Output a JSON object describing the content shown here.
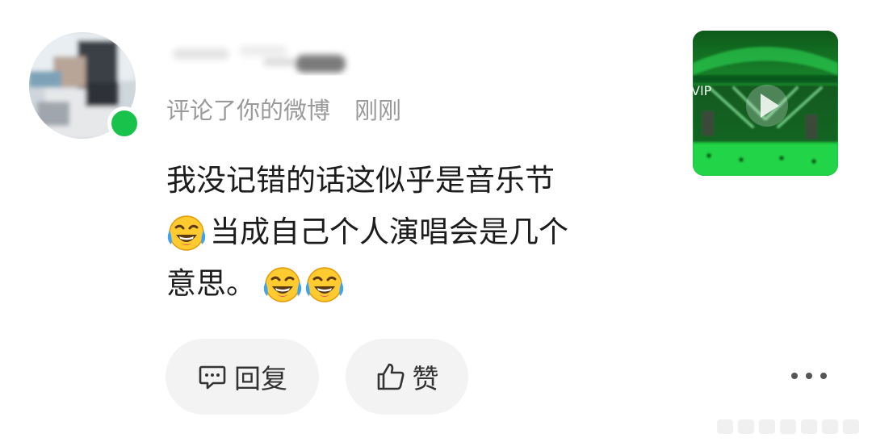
{
  "comment_card": {
    "action_text": "评论了你的微博",
    "time": "刚刚",
    "content_lines": [
      "我没记错的话这似乎是音乐节",
      "当成自己个人演唱会是几个",
      "意思。"
    ],
    "emoji_name": "laughing-crying-emoji",
    "reply_label": "回复",
    "like_label": "赞",
    "thumbnail": {
      "kind": "video",
      "text": "VIP"
    }
  },
  "colors": {
    "online": "#19c24a",
    "meta_text": "#9a9a9a",
    "body_text": "#1c1c1c",
    "button_bg": "#f3f3f3",
    "thumb_green": "#1fbf3a"
  }
}
